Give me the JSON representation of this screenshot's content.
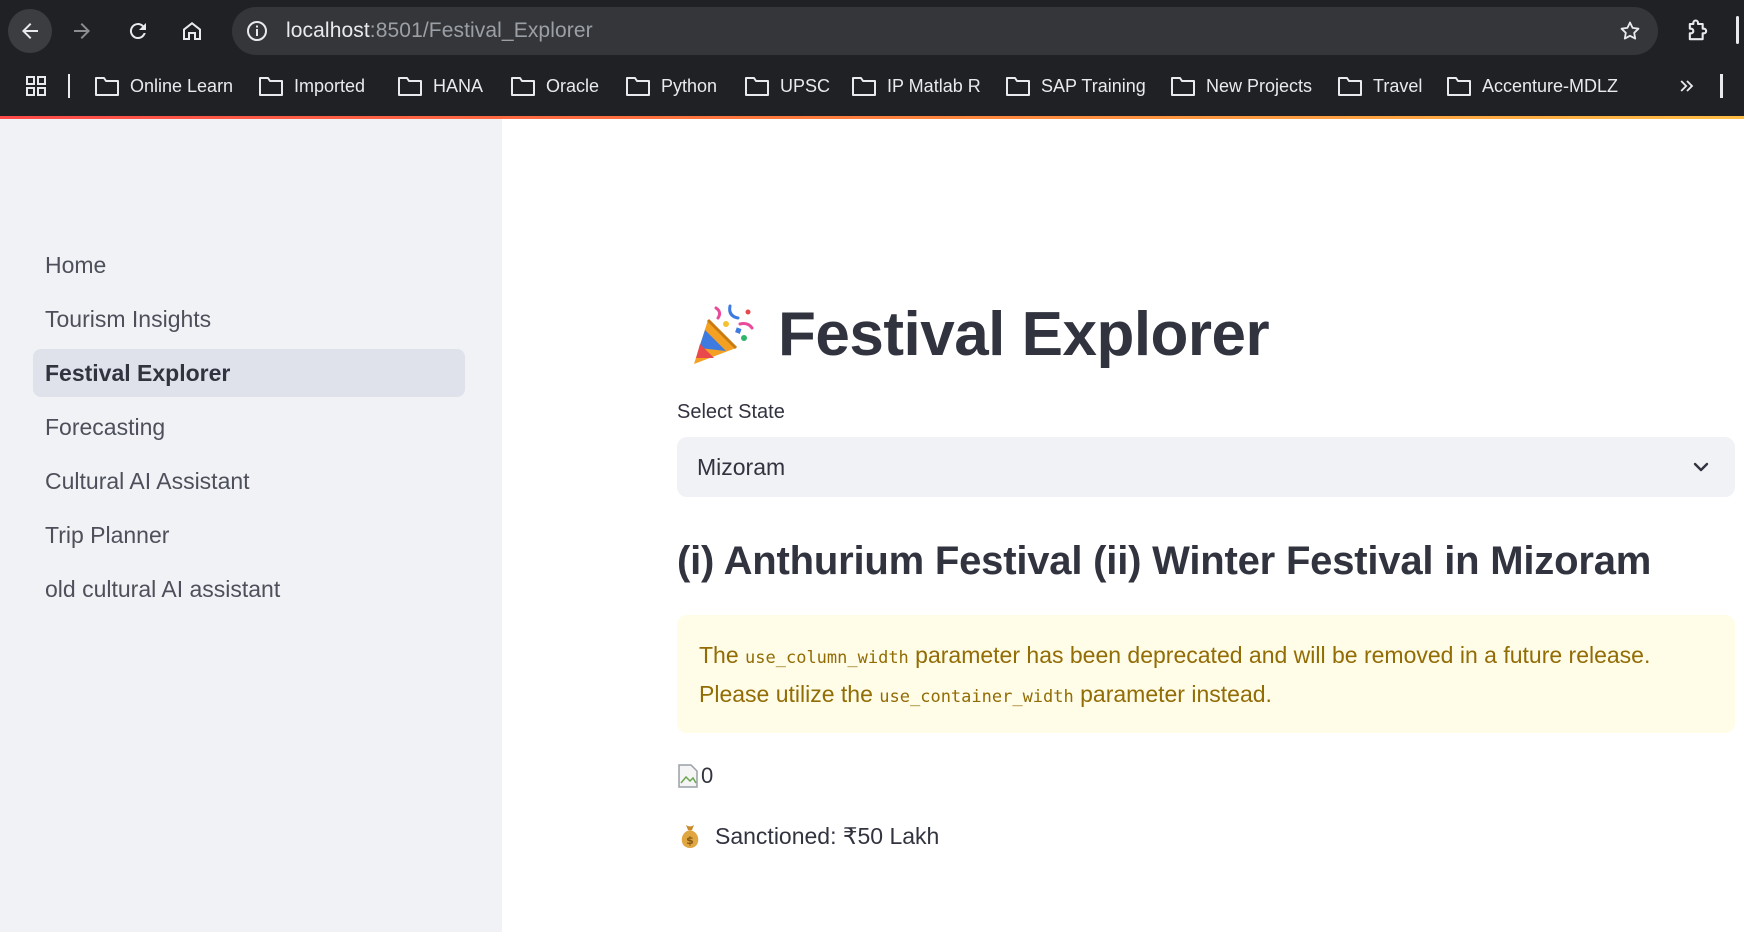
{
  "browser": {
    "url_host": "localhost",
    "url_path": ":8501/Festival_Explorer",
    "bookmarks": [
      {
        "label": "Online Learn"
      },
      {
        "label": "Imported"
      },
      {
        "label": "HANA"
      },
      {
        "label": "Oracle"
      },
      {
        "label": "Python"
      },
      {
        "label": "UPSC"
      },
      {
        "label": "IP Matlab R"
      },
      {
        "label": "SAP Training"
      },
      {
        "label": "New Projects"
      },
      {
        "label": "Travel"
      },
      {
        "label": "Accenture-MDLZ"
      }
    ]
  },
  "sidebar": {
    "items": [
      {
        "label": "Home"
      },
      {
        "label": "Tourism Insights"
      },
      {
        "label": "Festival Explorer",
        "active": true
      },
      {
        "label": "Forecasting"
      },
      {
        "label": "Cultural AI Assistant"
      },
      {
        "label": "Trip Planner"
      },
      {
        "label": "old cultural AI assistant"
      }
    ]
  },
  "main": {
    "title": "Festival Explorer",
    "select_label": "Select State",
    "selected_state": "Mizoram",
    "subheader": "(i) Anthurium Festival (ii) Winter Festival in Mizoram",
    "warning": {
      "text_1": "The ",
      "code_1": "use_column_width",
      "text_2": " parameter has been deprecated and will be removed in a future release. Please utilize the ",
      "code_2": "use_container_width",
      "text_3": " parameter instead."
    },
    "image_alt": "0",
    "sanctioned": "Sanctioned: ₹50 Lakh"
  },
  "colors": {
    "sidebar_bg": "#f0f2f6",
    "active_item_bg": "#dfe2ea",
    "warning_bg": "#fffce7",
    "warning_text": "#926c05",
    "text": "#31333f"
  }
}
